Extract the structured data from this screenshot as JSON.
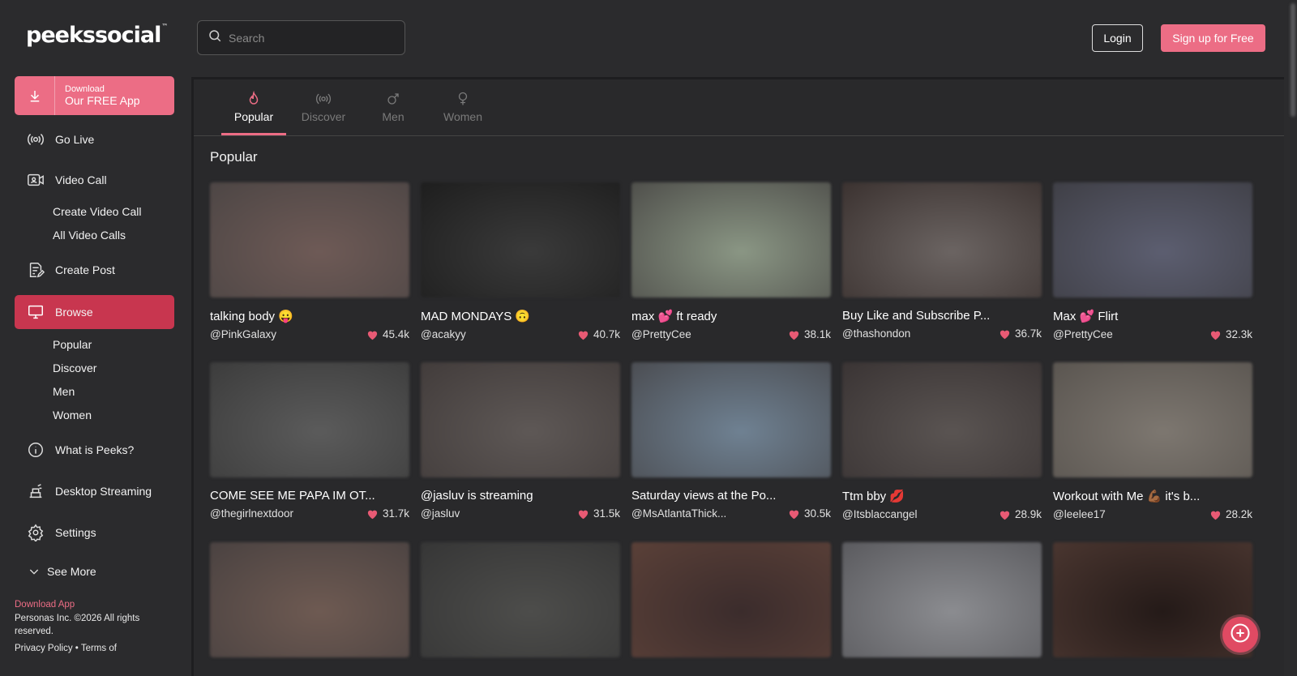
{
  "brand": {
    "logo": "peekssocial",
    "tm": "™",
    "accent": "#ec6d85"
  },
  "sidebar": {
    "download": {
      "small": "Download",
      "big": "Our FREE App"
    },
    "items": [
      {
        "label": "Go Live",
        "icon": "broadcast-icon"
      },
      {
        "label": "Video Call",
        "icon": "video-call-icon"
      },
      {
        "label": "Create Post",
        "icon": "create-post-icon"
      },
      {
        "label": "Browse",
        "icon": "browse-icon"
      },
      {
        "label": "What is Peeks?",
        "icon": "info-icon"
      },
      {
        "label": "Desktop Streaming",
        "icon": "desktop-streaming-icon"
      },
      {
        "label": "Settings",
        "icon": "gear-icon"
      }
    ],
    "video_sub": [
      "Create Video Call",
      "All Video Calls"
    ],
    "browse_sub": [
      "Popular",
      "Discover",
      "Men",
      "Women"
    ],
    "see_more": "See More",
    "footer": {
      "download_link": "Download App",
      "copyright": "Personas Inc. ©2026 All rights reserved.",
      "privacy": "Privacy Policy",
      "sep": "•",
      "terms": "Terms of"
    }
  },
  "header": {
    "search_placeholder": "Search",
    "login": "Login",
    "signup": "Sign up for Free"
  },
  "tabs": [
    {
      "label": "Popular",
      "icon": "fire-icon",
      "active": true
    },
    {
      "label": "Discover",
      "icon": "broadcast-icon",
      "active": false
    },
    {
      "label": "Men",
      "icon": "male-icon",
      "active": false
    },
    {
      "label": "Women",
      "icon": "female-icon",
      "active": false
    }
  ],
  "section_title": "Popular",
  "cards": [
    {
      "title": "talking body 😛",
      "user": "@PinkGalaxy",
      "likes": "45.4k",
      "colors": [
        "#6e5a56",
        "#4d4645"
      ]
    },
    {
      "title": "MAD MONDAYS 🙃",
      "user": "@acakyy",
      "likes": "40.7k",
      "colors": [
        "#3a3a3a",
        "#1e1e1e"
      ]
    },
    {
      "title": "max 💕 ft ready",
      "user": "@PrettyCee",
      "likes": "38.1k",
      "colors": [
        "#8a9684",
        "#4f4f4b"
      ]
    },
    {
      "title": "Buy Like and Subscribe P...",
      "user": "@thashondon",
      "likes": "36.7k",
      "colors": [
        "#6b6462",
        "#3b3230"
      ]
    },
    {
      "title": "Max 💕 Flirt",
      "user": "@PrettyCee",
      "likes": "32.3k",
      "colors": [
        "#5c5e70",
        "#3f3f46"
      ]
    },
    {
      "title": "COME SEE ME PAPA IM OT...",
      "user": "@thegirlnextdoor",
      "likes": "31.7k",
      "colors": [
        "#5b5b5b",
        "#3c3c3c"
      ]
    },
    {
      "title": "@jasluv is streaming",
      "user": "@jasluv",
      "likes": "31.5k",
      "colors": [
        "#5e5856",
        "#423c3b"
      ]
    },
    {
      "title": "Saturday views at the Po...",
      "user": "@MsAtlantaThick...",
      "likes": "30.5k",
      "colors": [
        "#6f8192",
        "#4b4d52"
      ]
    },
    {
      "title": "Ttm bby 💋",
      "user": "@Itsblaccangel",
      "likes": "28.9k",
      "colors": [
        "#5a5452",
        "#3a3434"
      ]
    },
    {
      "title": "Workout with Me 💪🏾 it's b...",
      "user": "@leelee17",
      "likes": "28.2k",
      "colors": [
        "#7d7770",
        "#5a5550"
      ]
    },
    {
      "title": "",
      "user": "",
      "likes": "",
      "colors": [
        "#6e5a52",
        "#4a4241"
      ]
    },
    {
      "title": "",
      "user": "",
      "likes": "",
      "colors": [
        "#4d4d4b",
        "#363636"
      ]
    },
    {
      "title": "",
      "user": "",
      "likes": "",
      "colors": [
        "#3b2c2c",
        "#5a4038"
      ]
    },
    {
      "title": "",
      "user": "",
      "likes": "",
      "colors": [
        "#8b8c90",
        "#5a5a5e"
      ]
    },
    {
      "title": "",
      "user": "",
      "likes": "",
      "colors": [
        "#241a18",
        "#4a3630"
      ]
    }
  ]
}
